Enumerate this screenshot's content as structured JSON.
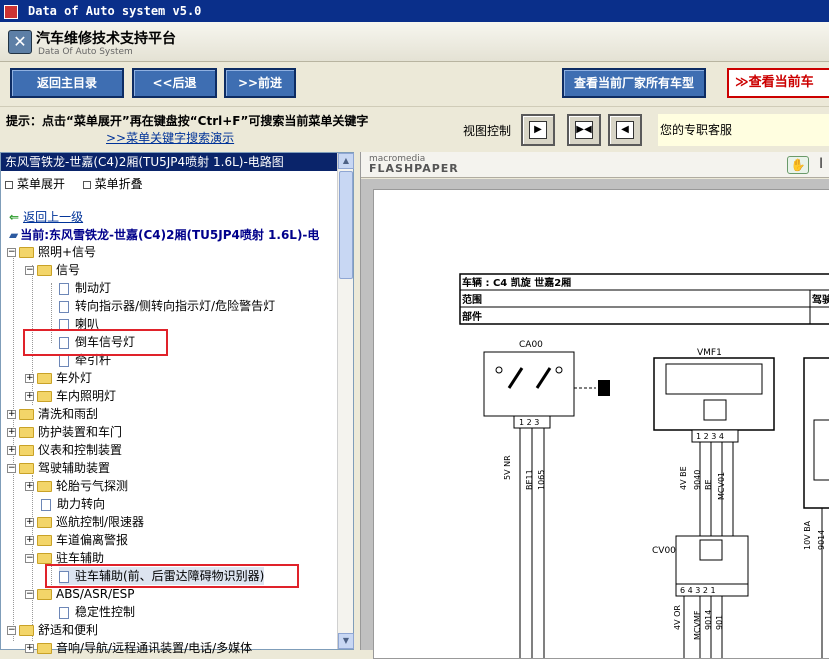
{
  "window": {
    "title": "Data of Auto system v5.0"
  },
  "header": {
    "title": "汽车维修技术支持平台",
    "subtitle": "Data Of Auto System"
  },
  "toolbar": {
    "home": "返回主目录",
    "back": "<<后退",
    "forward": ">>前进",
    "all_models": "查看当前厂家所有车型",
    "current_model": "查看当前车"
  },
  "hint": {
    "text": "提示：点击“菜单展开”再在键盘按“Ctrl+F”可搜索当前菜单关键字",
    "link": ">>菜单关键字搜索演示"
  },
  "view_control": {
    "label": "视图控制"
  },
  "service": "您的专职客服",
  "left_panel": {
    "header": "东风雪铁龙-世嘉(C4)2厢(TU5JP4喷射 1.6L)-电路图",
    "expand": "菜单展开",
    "collapse": "菜单折叠",
    "back_link": "返回上一级",
    "current": "当前:东风雪铁龙-世嘉(C4)2厢(TU5JP4喷射 1.6L)-电",
    "tree": [
      {
        "label": "照明+信号"
      },
      {
        "label": "信号"
      },
      {
        "label": "制动灯"
      },
      {
        "label": "转向指示器/侧转向指示灯/危险警告灯"
      },
      {
        "label": "喇叭"
      },
      {
        "label": "倒车信号灯"
      },
      {
        "label": "牵引杆"
      },
      {
        "label": "车外灯"
      },
      {
        "label": "车内照明灯"
      },
      {
        "label": "清洗和雨刮"
      },
      {
        "label": "防护装置和车门"
      },
      {
        "label": "仪表和控制装置"
      },
      {
        "label": "驾驶辅助装置"
      },
      {
        "label": "轮胎亏气探测"
      },
      {
        "label": "助力转向"
      },
      {
        "label": "巡航控制/限速器"
      },
      {
        "label": "车道偏离警报"
      },
      {
        "label": "驻车辅助"
      },
      {
        "label": "驻车辅助(前、后雷达障碍物识别器)"
      },
      {
        "label": "ABS/ASR/ESP"
      },
      {
        "label": "稳定性控制"
      },
      {
        "label": "舒适和便利"
      },
      {
        "label": "音响/导航/远程通讯装置/电话/多媒体"
      }
    ]
  },
  "viewer": {
    "brand_top": "macromedia",
    "brand_main": "FLASHPAPER",
    "schematic": {
      "row_vehicle": "车辆 : C4 凯旋 世嘉2厢",
      "row_scope": "范围",
      "row_parts": "部件",
      "row_right": "驾驶",
      "ca00": "CA00",
      "vmf1": "VMF1",
      "cv00": "CV00",
      "w1": "5V NR",
      "w2": "BE11",
      "w3": "1065",
      "w4": "4V BE",
      "w5": "9040",
      "w6": "BE",
      "w7": "MCV01",
      "w8": "4V OR",
      "w9": "MCVMF",
      "w10": "9014",
      "w11": "901",
      "w12": "10V BA",
      "w13": "9014"
    }
  }
}
